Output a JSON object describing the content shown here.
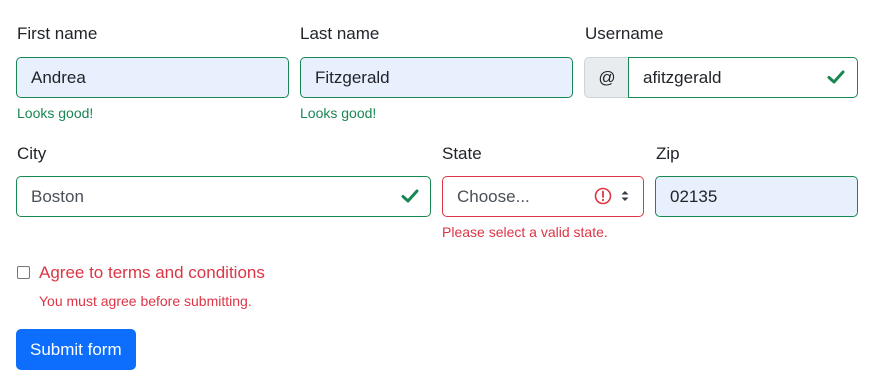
{
  "form": {
    "first_name": {
      "label": "First name",
      "value": "Andrea",
      "feedback": "Looks good!"
    },
    "last_name": {
      "label": "Last name",
      "value": "Fitzgerald",
      "feedback": "Looks good!"
    },
    "username": {
      "label": "Username",
      "prefix": "@",
      "value": "afitzgerald"
    },
    "city": {
      "label": "City",
      "value": "Boston"
    },
    "state": {
      "label": "State",
      "selected": "Choose...",
      "feedback": "Please select a valid state."
    },
    "zip": {
      "label": "Zip",
      "value": "02135"
    },
    "terms": {
      "label": "Agree to terms and conditions",
      "checked": false,
      "feedback": "You must agree before submitting."
    },
    "submit_label": "Submit form"
  },
  "colors": {
    "valid": "#198754",
    "invalid": "#dc3545",
    "primary": "#0d6efd",
    "autofill": "#e8f0fe"
  },
  "icons": {
    "valid": "check-icon",
    "invalid": "exclamation-circle-icon",
    "select": "sort-arrows-icon"
  }
}
